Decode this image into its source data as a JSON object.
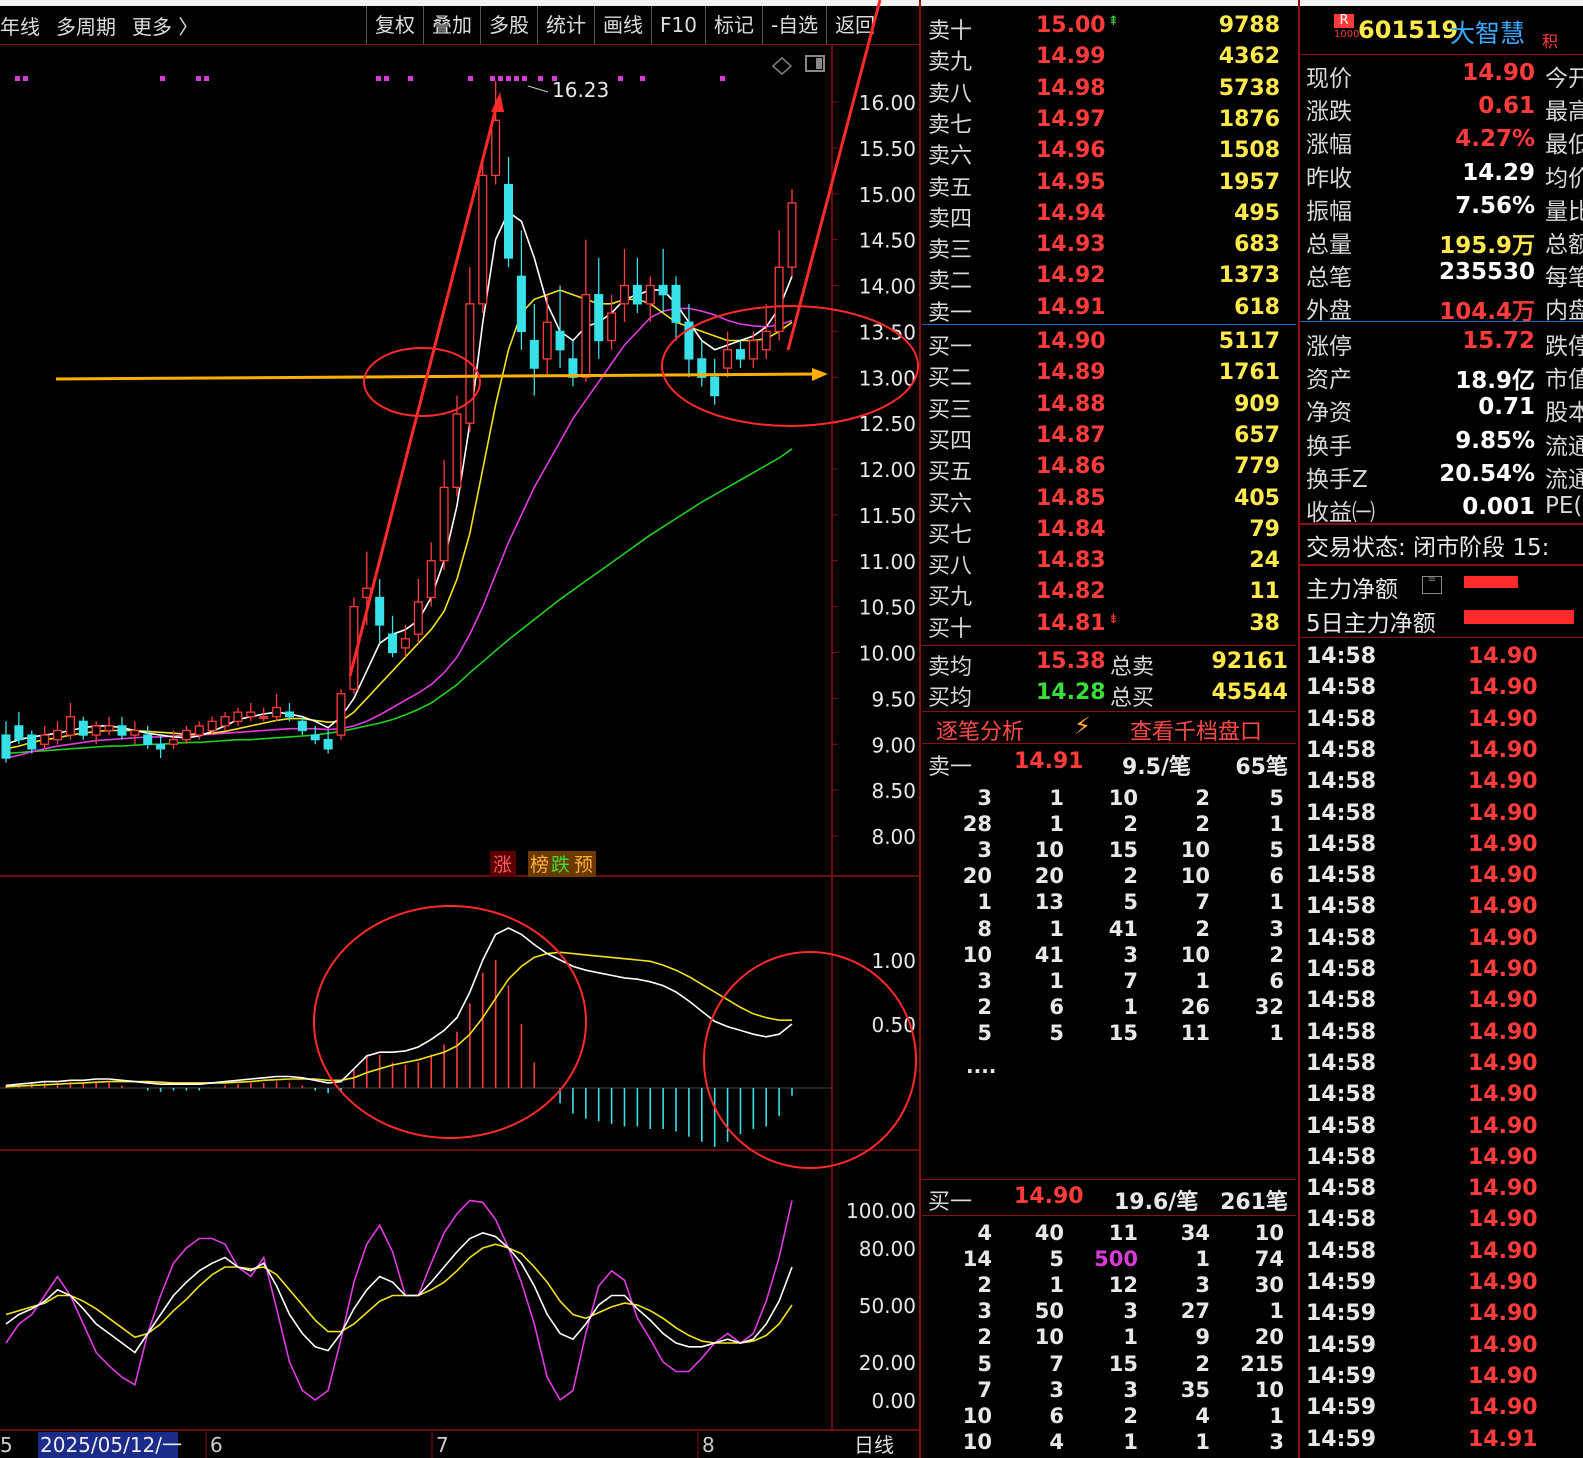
{
  "toolbar": {
    "left_tabs": [
      "年线",
      "多周期",
      "更多 〉"
    ],
    "buttons": [
      "复权",
      "叠加",
      "多股",
      "统计",
      "画线",
      "F10",
      "标记",
      "-自选",
      "返回"
    ]
  },
  "chart": {
    "price_axis": [
      "16.00",
      "15.50",
      "15.00",
      "14.50",
      "14.00",
      "13.50",
      "13.00",
      "12.50",
      "12.00",
      "11.50",
      "11.00",
      "10.50",
      "10.00",
      "9.50",
      "9.00",
      "8.50",
      "8.00"
    ],
    "high_label": "16.23",
    "tags": {
      "zhang": "涨",
      "bang": "榜",
      "die": "跌",
      "yu": "预"
    },
    "macd_axis": [
      "1.00",
      "0.50"
    ],
    "kdj_axis": [
      "100.00",
      "80.00",
      "50.00",
      "20.00",
      "0.00"
    ],
    "date_axis": {
      "left_frag": "5",
      "date": "2025/05/12/一",
      "m6": "6",
      "m7": "7",
      "m8": "8",
      "period": "日线"
    }
  },
  "chart_data": {
    "type": "candlestick",
    "ylim": [
      7.7,
      16.5
    ],
    "candles": [
      [
        9.1,
        9.25,
        8.85,
        8.8
      ],
      [
        9.2,
        9.35,
        9.05,
        9.0
      ],
      [
        9.1,
        9.15,
        8.95,
        8.9
      ],
      [
        9.0,
        9.2,
        9.1,
        8.95
      ],
      [
        9.05,
        9.25,
        9.15,
        9.0
      ],
      [
        9.1,
        9.45,
        9.3,
        9.05
      ],
      [
        9.25,
        9.3,
        9.1,
        9.05
      ],
      [
        9.1,
        9.25,
        9.2,
        9.0
      ],
      [
        9.15,
        9.3,
        9.2,
        9.1
      ],
      [
        9.2,
        9.3,
        9.1,
        9.05
      ],
      [
        9.1,
        9.25,
        9.15,
        9.0
      ],
      [
        9.1,
        9.2,
        9.0,
        8.95
      ],
      [
        9.0,
        9.1,
        8.95,
        8.85
      ],
      [
        9.0,
        9.15,
        9.05,
        8.95
      ],
      [
        9.05,
        9.2,
        9.15,
        9.0
      ],
      [
        9.1,
        9.25,
        9.2,
        9.05
      ],
      [
        9.15,
        9.3,
        9.25,
        9.1
      ],
      [
        9.2,
        9.35,
        9.3,
        9.15
      ],
      [
        9.25,
        9.4,
        9.35,
        9.2
      ],
      [
        9.3,
        9.45,
        9.35,
        9.25
      ],
      [
        9.3,
        9.4,
        9.3,
        9.25
      ],
      [
        9.3,
        9.55,
        9.4,
        9.25
      ],
      [
        9.35,
        9.45,
        9.3,
        9.25
      ],
      [
        9.25,
        9.3,
        9.15,
        9.1
      ],
      [
        9.1,
        9.2,
        9.05,
        9.0
      ],
      [
        9.05,
        9.15,
        8.95,
        8.9
      ],
      [
        9.1,
        9.6,
        9.55,
        9.05
      ],
      [
        9.6,
        10.6,
        10.5,
        9.55
      ],
      [
        10.6,
        11.1,
        10.7,
        10.3
      ],
      [
        10.6,
        10.8,
        10.3,
        10.1
      ],
      [
        10.2,
        10.4,
        10.0,
        9.95
      ],
      [
        10.05,
        10.3,
        10.15,
        9.95
      ],
      [
        10.2,
        10.8,
        10.55,
        10.1
      ],
      [
        10.6,
        11.2,
        11.0,
        10.5
      ],
      [
        11.0,
        12.1,
        11.8,
        10.9
      ],
      [
        11.8,
        12.8,
        12.6,
        11.7
      ],
      [
        12.5,
        14.2,
        13.8,
        12.4
      ],
      [
        13.8,
        15.4,
        15.2,
        13.7
      ],
      [
        15.2,
        16.23,
        15.8,
        15.1
      ],
      [
        15.1,
        15.4,
        14.3,
        14.2
      ],
      [
        14.1,
        14.6,
        13.5,
        13.3
      ],
      [
        13.4,
        13.8,
        13.1,
        12.8
      ],
      [
        13.2,
        13.9,
        13.6,
        13.0
      ],
      [
        13.5,
        14.0,
        13.3,
        13.1
      ],
      [
        13.2,
        13.4,
        13.0,
        12.9
      ],
      [
        13.0,
        14.5,
        13.9,
        12.95
      ],
      [
        13.9,
        14.3,
        13.4,
        13.2
      ],
      [
        13.4,
        13.9,
        13.7,
        13.3
      ],
      [
        13.8,
        14.4,
        14.0,
        13.6
      ],
      [
        14.0,
        14.3,
        13.8,
        13.7
      ],
      [
        13.8,
        14.1,
        14.0,
        13.6
      ],
      [
        14.0,
        14.4,
        13.9,
        13.7
      ],
      [
        14.0,
        14.1,
        13.6,
        13.4
      ],
      [
        13.6,
        13.8,
        13.2,
        13.0
      ],
      [
        13.2,
        13.4,
        13.0,
        12.9
      ],
      [
        13.0,
        13.2,
        12.8,
        12.7
      ],
      [
        13.1,
        13.5,
        13.3,
        13.0
      ],
      [
        13.3,
        13.4,
        13.2,
        13.1
      ],
      [
        13.2,
        13.5,
        13.4,
        13.1
      ],
      [
        13.3,
        13.8,
        13.5,
        13.2
      ],
      [
        13.5,
        14.6,
        14.2,
        13.4
      ],
      [
        14.2,
        15.05,
        14.9,
        14.1
      ]
    ],
    "ma5": [
      9.0,
      9.05,
      9.08,
      9.1,
      9.12,
      9.15,
      9.18,
      9.2,
      9.2,
      9.18,
      9.15,
      9.12,
      9.1,
      9.08,
      9.07,
      9.09,
      9.14,
      9.2,
      9.27,
      9.3,
      9.33,
      9.35,
      9.33,
      9.3,
      9.25,
      9.18,
      9.3,
      9.5,
      9.8,
      10.1,
      10.2,
      10.25,
      10.35,
      10.6,
      11.0,
      11.6,
      12.5,
      13.6,
      14.5,
      14.8,
      14.7,
      14.3,
      13.8,
      13.5,
      13.4,
      13.55,
      13.6,
      13.7,
      13.85,
      13.9,
      13.95,
      13.95,
      13.8,
      13.6,
      13.4,
      13.3,
      13.35,
      13.4,
      13.45,
      13.55,
      13.75,
      14.1
    ],
    "ma10": [
      8.95,
      8.98,
      9.02,
      9.05,
      9.07,
      9.1,
      9.12,
      9.14,
      9.15,
      9.15,
      9.15,
      9.14,
      9.13,
      9.12,
      9.11,
      9.11,
      9.12,
      9.14,
      9.17,
      9.2,
      9.23,
      9.26,
      9.28,
      9.28,
      9.26,
      9.24,
      9.25,
      9.35,
      9.5,
      9.65,
      9.8,
      9.95,
      10.1,
      10.25,
      10.45,
      10.8,
      11.3,
      12.0,
      12.7,
      13.3,
      13.7,
      13.85,
      13.9,
      13.95,
      13.9,
      13.85,
      13.8,
      13.8,
      13.85,
      13.85,
      13.8,
      13.7,
      13.6,
      13.55,
      13.5,
      13.45,
      13.4,
      13.4,
      13.4,
      13.42,
      13.5,
      13.6
    ],
    "ma20": [
      8.85,
      8.88,
      8.92,
      8.95,
      8.98,
      9.0,
      9.02,
      9.04,
      9.05,
      9.06,
      9.07,
      9.08,
      9.08,
      9.09,
      9.1,
      9.1,
      9.11,
      9.12,
      9.13,
      9.14,
      9.15,
      9.16,
      9.17,
      9.17,
      9.17,
      9.16,
      9.17,
      9.2,
      9.25,
      9.32,
      9.4,
      9.48,
      9.56,
      9.65,
      9.78,
      9.95,
      10.2,
      10.5,
      10.85,
      11.2,
      11.5,
      11.8,
      12.05,
      12.3,
      12.55,
      12.75,
      12.95,
      13.15,
      13.35,
      13.5,
      13.65,
      13.72,
      13.75,
      13.75,
      13.72,
      13.68,
      13.62,
      13.58,
      13.56,
      13.55,
      13.57,
      13.62
    ],
    "ma60": [
      8.9,
      8.91,
      8.92,
      8.93,
      8.94,
      8.95,
      8.96,
      8.97,
      8.98,
      8.98,
      8.99,
      9.0,
      9.0,
      9.01,
      9.02,
      9.02,
      9.03,
      9.04,
      9.05,
      9.05,
      9.06,
      9.07,
      9.08,
      9.09,
      9.1,
      9.12,
      9.14,
      9.17,
      9.2,
      9.23,
      9.27,
      9.32,
      9.38,
      9.45,
      9.55,
      9.65,
      9.78,
      9.9,
      10.02,
      10.14,
      10.25,
      10.36,
      10.47,
      10.58,
      10.68,
      10.78,
      10.88,
      10.98,
      11.08,
      11.18,
      11.28,
      11.37,
      11.46,
      11.55,
      11.64,
      11.72,
      11.8,
      11.88,
      11.96,
      12.04,
      12.12,
      12.22
    ],
    "macd_dif": [
      0.02,
      0.03,
      0.04,
      0.05,
      0.05,
      0.06,
      0.06,
      0.07,
      0.07,
      0.06,
      0.05,
      0.04,
      0.03,
      0.03,
      0.03,
      0.03,
      0.04,
      0.05,
      0.06,
      0.07,
      0.08,
      0.09,
      0.09,
      0.08,
      0.06,
      0.04,
      0.05,
      0.15,
      0.25,
      0.28,
      0.28,
      0.29,
      0.32,
      0.38,
      0.45,
      0.55,
      0.75,
      1.0,
      1.2,
      1.25,
      1.2,
      1.12,
      1.05,
      1.0,
      0.95,
      0.92,
      0.9,
      0.88,
      0.86,
      0.85,
      0.83,
      0.8,
      0.75,
      0.68,
      0.6,
      0.52,
      0.48,
      0.45,
      0.42,
      0.4,
      0.42,
      0.5
    ],
    "macd_dea": [
      0.01,
      0.015,
      0.02,
      0.025,
      0.03,
      0.035,
      0.04,
      0.045,
      0.05,
      0.05,
      0.05,
      0.05,
      0.045,
      0.04,
      0.04,
      0.04,
      0.04,
      0.04,
      0.045,
      0.05,
      0.06,
      0.065,
      0.07,
      0.07,
      0.07,
      0.06,
      0.06,
      0.08,
      0.12,
      0.15,
      0.18,
      0.2,
      0.22,
      0.25,
      0.28,
      0.33,
      0.42,
      0.55,
      0.7,
      0.85,
      0.95,
      1.02,
      1.05,
      1.06,
      1.05,
      1.04,
      1.03,
      1.02,
      1.01,
      1.0,
      0.99,
      0.96,
      0.92,
      0.87,
      0.81,
      0.75,
      0.69,
      0.63,
      0.58,
      0.55,
      0.53,
      0.53
    ],
    "kdj_k": [
      40,
      45,
      48,
      52,
      58,
      55,
      48,
      40,
      35,
      30,
      25,
      35,
      45,
      55,
      62,
      68,
      72,
      75,
      70,
      68,
      72,
      60,
      45,
      35,
      28,
      26,
      35,
      48,
      58,
      65,
      62,
      55,
      55,
      62,
      70,
      78,
      85,
      88,
      86,
      80,
      72,
      60,
      45,
      35,
      32,
      40,
      50,
      55,
      55,
      48,
      42,
      35,
      30,
      28,
      28,
      30,
      32,
      30,
      32,
      40,
      52,
      70
    ],
    "kdj_d": [
      45,
      47,
      49,
      51,
      55,
      55,
      52,
      48,
      43,
      38,
      33,
      35,
      40,
      47,
      53,
      60,
      66,
      70,
      70,
      69,
      70,
      66,
      58,
      50,
      42,
      36,
      36,
      40,
      46,
      52,
      55,
      55,
      55,
      58,
      62,
      68,
      75,
      80,
      82,
      80,
      77,
      70,
      62,
      52,
      45,
      43,
      46,
      49,
      51,
      50,
      47,
      43,
      38,
      34,
      31,
      30,
      30,
      30,
      31,
      34,
      40,
      50
    ],
    "kdj_j": [
      30,
      40,
      45,
      55,
      65,
      55,
      40,
      25,
      18,
      12,
      8,
      35,
      55,
      72,
      80,
      85,
      85,
      82,
      70,
      65,
      75,
      48,
      20,
      5,
      0,
      5,
      32,
      62,
      82,
      92,
      78,
      55,
      55,
      72,
      88,
      98,
      105,
      104,
      95,
      80,
      62,
      40,
      12,
      0,
      5,
      35,
      60,
      68,
      63,
      43,
      32,
      20,
      15,
      15,
      22,
      30,
      35,
      30,
      35,
      52,
      75,
      105
    ]
  },
  "orderbook": {
    "asks": [
      {
        "label": "卖十",
        "price": "15.00",
        "vol": "9788",
        "arrow": "up"
      },
      {
        "label": "卖九",
        "price": "14.99",
        "vol": "4362"
      },
      {
        "label": "卖八",
        "price": "14.98",
        "vol": "5738"
      },
      {
        "label": "卖七",
        "price": "14.97",
        "vol": "1876"
      },
      {
        "label": "卖六",
        "price": "14.96",
        "vol": "1508"
      },
      {
        "label": "卖五",
        "price": "14.95",
        "vol": "1957"
      },
      {
        "label": "卖四",
        "price": "14.94",
        "vol": "495"
      },
      {
        "label": "卖三",
        "price": "14.93",
        "vol": "683"
      },
      {
        "label": "卖二",
        "price": "14.92",
        "vol": "1373"
      },
      {
        "label": "卖一",
        "price": "14.91",
        "vol": "618"
      }
    ],
    "bids": [
      {
        "label": "买一",
        "price": "14.90",
        "vol": "5117"
      },
      {
        "label": "买二",
        "price": "14.89",
        "vol": "1761"
      },
      {
        "label": "买三",
        "price": "14.88",
        "vol": "909"
      },
      {
        "label": "买四",
        "price": "14.87",
        "vol": "657"
      },
      {
        "label": "买五",
        "price": "14.86",
        "vol": "779"
      },
      {
        "label": "买六",
        "price": "14.85",
        "vol": "405"
      },
      {
        "label": "买七",
        "price": "14.84",
        "vol": "79"
      },
      {
        "label": "买八",
        "price": "14.83",
        "vol": "24"
      },
      {
        "label": "买九",
        "price": "14.82",
        "vol": "11"
      },
      {
        "label": "买十",
        "price": "14.81",
        "vol": "38",
        "arrow": "down"
      }
    ],
    "sell_avg_label": "卖均",
    "sell_avg": "15.38",
    "total_sell_label": "总卖",
    "total_sell": "92161",
    "buy_avg_label": "买均",
    "buy_avg": "14.28",
    "total_buy_label": "总买",
    "total_buy": "45544",
    "tab_tick": "逐笔分析",
    "tab_depth": "查看千档盘口",
    "ask_queue": {
      "label": "卖一",
      "price": "14.91",
      "avg": "9.5/笔",
      "count": "65笔",
      "rows": [
        [
          "3",
          "1",
          "10",
          "2",
          "5"
        ],
        [
          "28",
          "1",
          "2",
          "2",
          "1"
        ],
        [
          "3",
          "10",
          "15",
          "10",
          "5"
        ],
        [
          "20",
          "20",
          "2",
          "10",
          "6"
        ],
        [
          "1",
          "13",
          "5",
          "7",
          "1"
        ],
        [
          "8",
          "1",
          "41",
          "2",
          "3"
        ],
        [
          "10",
          "41",
          "3",
          "10",
          "2"
        ],
        [
          "3",
          "1",
          "7",
          "1",
          "6"
        ],
        [
          "2",
          "6",
          "1",
          "26",
          "32"
        ],
        [
          "5",
          "5",
          "15",
          "11",
          "1"
        ]
      ],
      "more": "...."
    },
    "bid_queue": {
      "label": "买一",
      "price": "14.90",
      "avg": "19.6/笔",
      "count": "261笔",
      "rows": [
        [
          "4",
          "40",
          "11",
          "34",
          "10"
        ],
        [
          "14",
          "5",
          "500",
          "1",
          "74"
        ],
        [
          "2",
          "1",
          "12",
          "3",
          "30"
        ],
        [
          "3",
          "50",
          "3",
          "27",
          "1"
        ],
        [
          "2",
          "10",
          "1",
          "9",
          "20"
        ],
        [
          "5",
          "7",
          "15",
          "2",
          "215"
        ],
        [
          "7",
          "3",
          "3",
          "35",
          "10"
        ],
        [
          "10",
          "6",
          "2",
          "4",
          "1"
        ],
        [
          "10",
          "4",
          "1",
          "1",
          "3"
        ]
      ]
    }
  },
  "stock": {
    "code": "601519",
    "name": "大智慧",
    "badge_top": "R",
    "badge_bottom": "1000",
    "tag": "积",
    "rows": [
      {
        "k": "现价",
        "v": "14.90",
        "c": "#ff3b3b",
        "k2": "今开"
      },
      {
        "k": "涨跌",
        "v": "0.61",
        "c": "#ff3b3b",
        "k2": "最高"
      },
      {
        "k": "涨幅",
        "v": "4.27%",
        "c": "#ff3b3b",
        "k2": "最低"
      },
      {
        "k": "昨收",
        "v": "14.29",
        "c": "#ffffff",
        "k2": "均价"
      },
      {
        "k": "振幅",
        "v": "7.56%",
        "c": "#ffffff",
        "k2": "量比"
      },
      {
        "k": "总量",
        "v": "195.9万",
        "c": "#ffe94d",
        "k2": "总额"
      },
      {
        "k": "总笔",
        "v": "235530",
        "c": "#ffffff",
        "k2": "每笔"
      },
      {
        "k": "外盘",
        "v": "104.4万",
        "c": "#ff3b3b",
        "k2": "内盘"
      }
    ],
    "rows2": [
      {
        "k": "涨停",
        "v": "15.72",
        "c": "#ff3b3b",
        "k2": "跌停"
      },
      {
        "k": "资产",
        "v": "18.9亿",
        "c": "#ffffff",
        "k2": "市值"
      },
      {
        "k": "净资",
        "v": "0.71",
        "c": "#ffffff",
        "k2": "股本"
      },
      {
        "k": "换手",
        "v": "9.85%",
        "c": "#ffffff",
        "k2": "流通"
      },
      {
        "k": "换手Z",
        "v": "20.54%",
        "c": "#ffffff",
        "k2": "流通"
      },
      {
        "k": "收益㈠",
        "v": "0.001",
        "c": "#ffffff",
        "k2": "PE("
      }
    ],
    "status": "交易状态: 闭市阶段 15:",
    "main_net": "主力净额",
    "main_net5": "5日主力净额"
  },
  "ticks": {
    "times": [
      "14:58",
      "14:58",
      "14:58",
      "14:58",
      "14:58",
      "14:58",
      "14:58",
      "14:58",
      "14:58",
      "14:58",
      "14:58",
      "14:58",
      "14:58",
      "14:58",
      "14:58",
      "14:58",
      "14:58",
      "14:58",
      "14:58",
      "14:58",
      "14:59",
      "14:59",
      "14:59",
      "14:59",
      "14:59",
      "14:59"
    ],
    "prices": [
      "14.90",
      "14.90",
      "14.90",
      "14.90",
      "14.90",
      "14.90",
      "14.90",
      "14.90",
      "14.90",
      "14.90",
      "14.90",
      "14.90",
      "14.90",
      "14.90",
      "14.90",
      "14.90",
      "14.90",
      "14.90",
      "14.90",
      "14.90",
      "14.90",
      "14.90",
      "14.90",
      "14.90",
      "14.90",
      "14.91"
    ]
  }
}
